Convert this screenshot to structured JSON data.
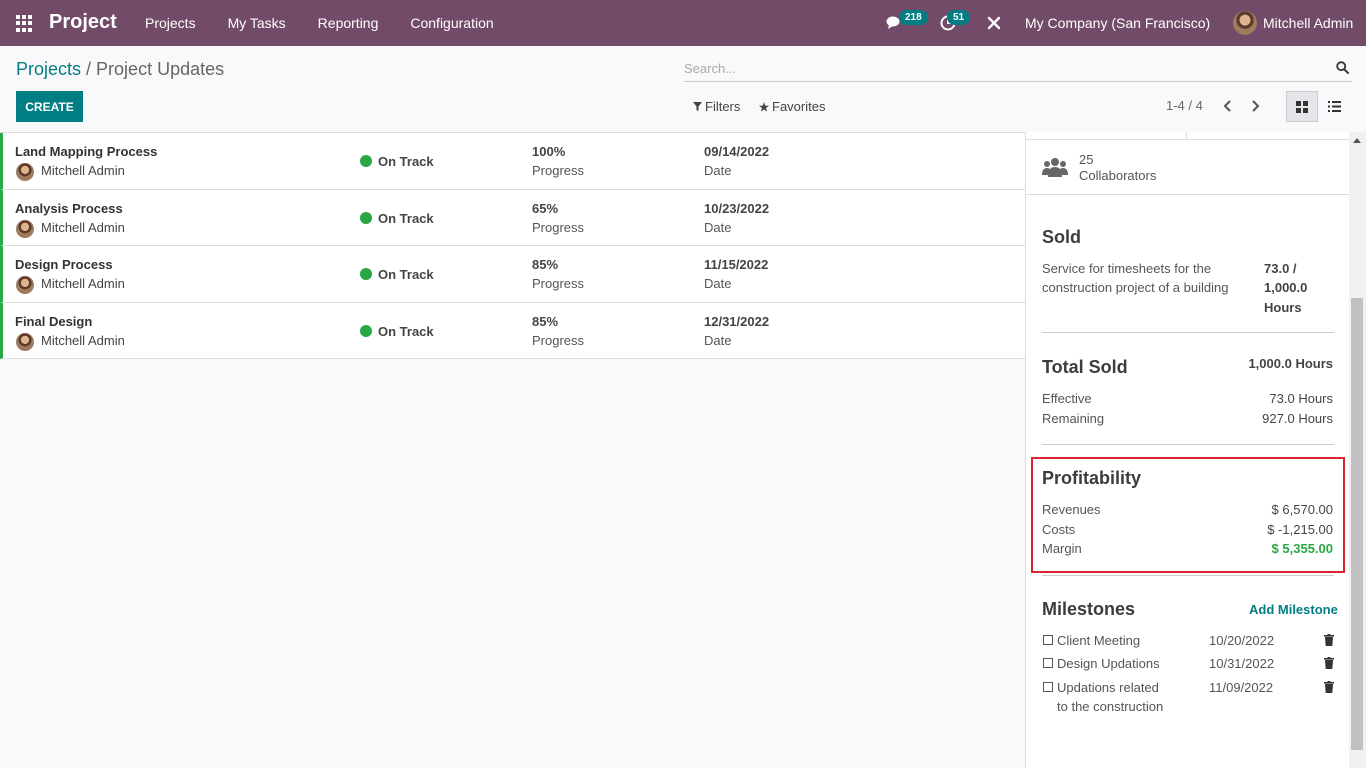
{
  "navbar": {
    "app_title": "Project",
    "menu": [
      "Projects",
      "My Tasks",
      "Reporting",
      "Configuration"
    ],
    "messages_count": "218",
    "activities_count": "51",
    "company": "My Company (San Francisco)",
    "user": "Mitchell Admin"
  },
  "breadcrumb": {
    "parent": "Projects",
    "separator": " / ",
    "current": "Project Updates"
  },
  "search": {
    "placeholder": "Search..."
  },
  "toolbar": {
    "create_label": "CREATE",
    "filters_label": "Filters",
    "favorites_label": "Favorites",
    "pager": "1-4 / 4"
  },
  "updates": [
    {
      "name": "Land Mapping Process",
      "user": "Mitchell Admin",
      "status": "On Track",
      "progress": "100%",
      "progress_label": "Progress",
      "date": "09/14/2022",
      "date_label": "Date"
    },
    {
      "name": "Analysis Process",
      "user": "Mitchell Admin",
      "status": "On Track",
      "progress": "65%",
      "progress_label": "Progress",
      "date": "10/23/2022",
      "date_label": "Date"
    },
    {
      "name": "Design Process",
      "user": "Mitchell Admin",
      "status": "On Track",
      "progress": "85%",
      "progress_label": "Progress",
      "date": "11/15/2022",
      "date_label": "Date"
    },
    {
      "name": "Final Design",
      "user": "Mitchell Admin",
      "status": "On Track",
      "progress": "85%",
      "progress_label": "Progress",
      "date": "12/31/2022",
      "date_label": "Date"
    }
  ],
  "panel": {
    "collaborators_count": "25",
    "collaborators_label": "Collaborators",
    "sold": {
      "title": "Sold",
      "item_line1": "Service for timesheets for the",
      "item_line2": "construction project of a building",
      "value_line1": "73.0 /",
      "value_line2": "1,000.0",
      "value_line3": "Hours"
    },
    "total_sold": {
      "title": "Total Sold",
      "total": "1,000.0 Hours",
      "effective_label": "Effective",
      "effective": "73.0 Hours",
      "remaining_label": "Remaining",
      "remaining": "927.0 Hours"
    },
    "profitability": {
      "title": "Profitability",
      "revenues_label": "Revenues",
      "revenues": "$ 6,570.00",
      "costs_label": "Costs",
      "costs": "$ -1,215.00",
      "margin_label": "Margin",
      "margin": "$ 5,355.00",
      "margin_color": "#28a745"
    },
    "milestones": {
      "title": "Milestones",
      "add_label": "Add Milestone",
      "items": [
        {
          "name_line1": "Client Meeting",
          "name_line2": "",
          "date": "10/20/2022"
        },
        {
          "name_line1": "Design Updations",
          "name_line2": "",
          "date": "10/31/2022"
        },
        {
          "name_line1": "Updations related",
          "name_line2": "to the construction",
          "date": "11/09/2022"
        }
      ]
    }
  },
  "colors": {
    "brand": "#714b67",
    "accent": "#017e84",
    "success": "#28a745",
    "highlight": "#d7262f"
  }
}
